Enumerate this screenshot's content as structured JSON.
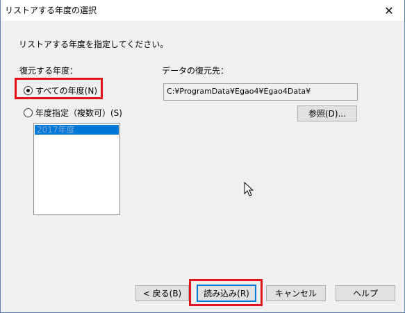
{
  "window": {
    "title": "リストアする年度の選択",
    "close_glyph": "✕"
  },
  "instruction": "リストアする年度を指定してください。",
  "restore_year": {
    "label": "復元する年度：",
    "options": [
      {
        "label": "すべての年度(N)",
        "checked": true
      },
      {
        "label": "年度指定（複数可）(S)",
        "checked": false
      }
    ],
    "list_items": [
      "2017年度"
    ]
  },
  "destination": {
    "label": "データの復元先：",
    "path": "C:¥ProgramData¥Egao4¥Egao4Data¥",
    "browse_label": "参照(D)..."
  },
  "footer": {
    "back_label": "< 戻る(B)",
    "load_label": "読み込み(R)",
    "cancel_label": "キャンセル",
    "help_label": "ヘルプ"
  },
  "colors": {
    "highlight": "#e2141b",
    "selection": "#0078d7",
    "default_button_border": "#0078d7"
  }
}
